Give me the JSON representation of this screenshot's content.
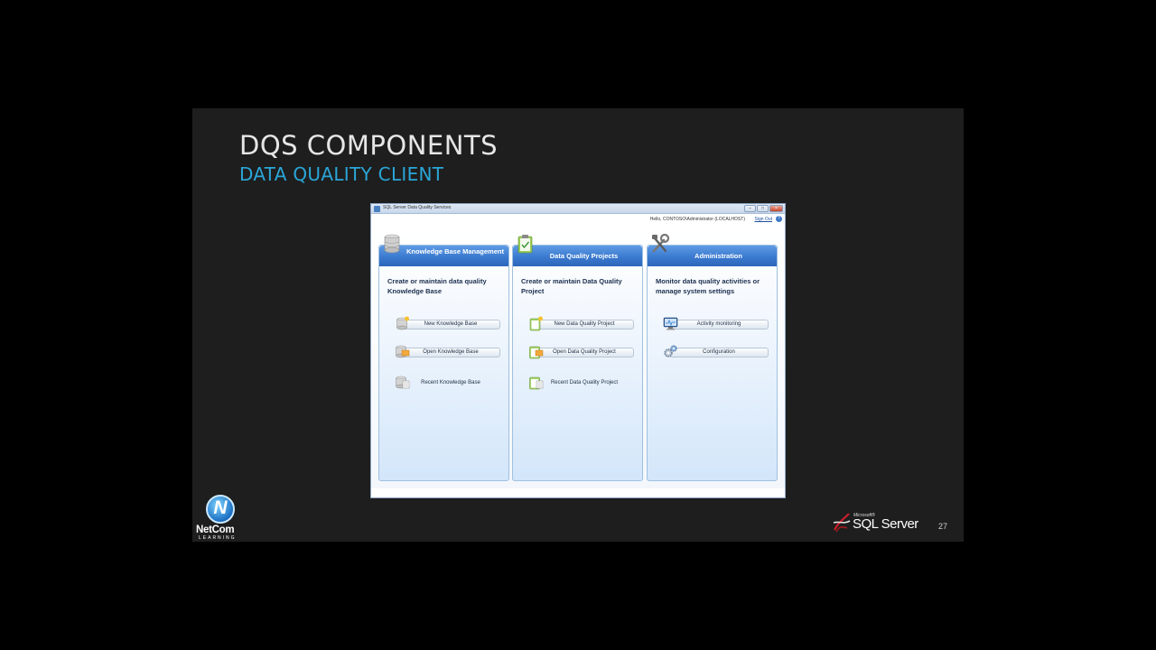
{
  "slide": {
    "title": "DQS COMPONENTS",
    "subtitle": "DATA QUALITY CLIENT",
    "page_number": "27"
  },
  "window": {
    "title": "SQL Server Data Quality Services",
    "user_greeting": "Hello, CONTOSO\\Administrator (LOCALHOST)",
    "sign_out": "Sign Out",
    "controls": [
      "minimize",
      "maximize",
      "close"
    ]
  },
  "panels": [
    {
      "header": "Knowledge Base Management",
      "icon": "database-icon",
      "description": "Create or maintain data quality Knowledge Base",
      "actions": [
        {
          "label": "New Knowledge Base",
          "icon": "new-database-icon"
        },
        {
          "label": "Open Knowledge Base",
          "icon": "open-database-icon"
        },
        {
          "label": "Recent Knowledge Base",
          "icon": "recent-database-icon"
        }
      ]
    },
    {
      "header": "Data Quality Projects",
      "icon": "clipboard-icon",
      "description": "Create or maintain Data Quality Project",
      "actions": [
        {
          "label": "New Data Quality Project",
          "icon": "new-project-icon"
        },
        {
          "label": "Open Data Quality Project",
          "icon": "open-project-icon"
        },
        {
          "label": "Recent Data Quality Project",
          "icon": "recent-project-icon"
        }
      ]
    },
    {
      "header": "Administration",
      "icon": "tools-icon",
      "description": "Monitor data quality activities or manage system settings",
      "actions": [
        {
          "label": "Activity monitoring",
          "icon": "monitor-icon"
        },
        {
          "label": "Configuration",
          "icon": "gears-icon"
        }
      ]
    }
  ],
  "logos": {
    "netcom_name": "NetCom",
    "netcom_sub": "LEARNING",
    "sql_small": "Microsoft®",
    "sql_name": "SQL Server"
  },
  "colors": {
    "slide_bg": "#1e1e1e",
    "subtitle": "#2aa6d8",
    "panel_header": "#3b7ad0"
  }
}
